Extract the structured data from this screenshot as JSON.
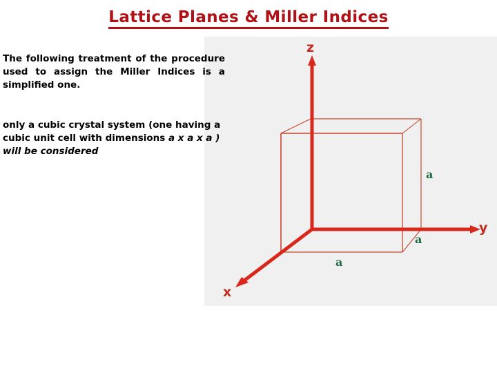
{
  "slide": {
    "title": "Lattice Planes & Miller Indices",
    "title_color": "#b01116",
    "background_color": "#ffffff",
    "figure_panel_color": "#f0f0f0"
  },
  "body": {
    "paragraph_1": "The following treatment of the procedure used to assign the Miller Indices is a simplified one.",
    "paragraph_2_plain_start": "only a cubic crystal system (one having a cubic unit cell with dimensions ",
    "paragraph_2_italic": "a x a x a ) will be considered"
  },
  "diagram": {
    "axis_color": "#c02a20",
    "cube_color": "#c9452f",
    "edge_label_color": "#1f6b40",
    "axes": [
      {
        "name": "z",
        "label": "z",
        "direction": "up"
      },
      {
        "name": "y",
        "label": "y",
        "direction": "right"
      },
      {
        "name": "x",
        "label": "x",
        "direction": "down-left"
      }
    ],
    "edge_labels": [
      {
        "name": "a-right",
        "label": "a"
      },
      {
        "name": "a-inner",
        "label": "a"
      },
      {
        "name": "a-bottom",
        "label": "a"
      }
    ],
    "shape": "cube",
    "caption": "cubic unit cell with edge length a on x, y and z axes"
  }
}
